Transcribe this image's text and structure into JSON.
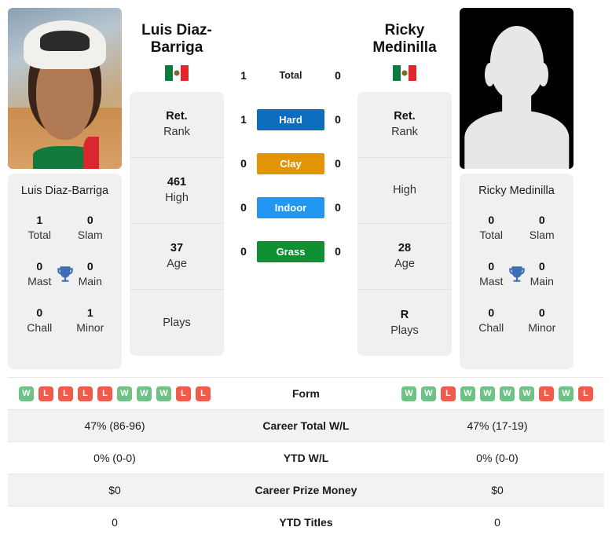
{
  "players": {
    "left": {
      "name": "Luis Diaz-Barriga",
      "name_line1": "Luis Diaz-",
      "name_line2": "Barriga",
      "flag": "mexico-flag",
      "photo": "player-photo",
      "rank": "Ret.",
      "rank_label": "Rank",
      "high": "461",
      "high_label": "High",
      "age": "37",
      "age_label": "Age",
      "plays": "",
      "plays_label": "Plays",
      "titles": {
        "total": "1",
        "total_label": "Total",
        "slam": "0",
        "slam_label": "Slam",
        "mast": "0",
        "mast_label": "Mast",
        "main": "0",
        "main_label": "Main",
        "chall": "0",
        "chall_label": "Chall",
        "minor": "1",
        "minor_label": "Minor"
      },
      "form": [
        "W",
        "L",
        "L",
        "L",
        "L",
        "W",
        "W",
        "W",
        "L",
        "L"
      ],
      "career_total_wl": "47% (86-96)",
      "ytd_wl": "0% (0-0)",
      "career_prize_money": "$0",
      "ytd_titles": "0"
    },
    "right": {
      "name": "Ricky Medinilla",
      "name_line1": "Ricky",
      "name_line2": "Medinilla",
      "flag": "mexico-flag",
      "photo": "player-photo-placeholder",
      "rank": "Ret.",
      "rank_label": "Rank",
      "high": "",
      "high_label": "High",
      "age": "28",
      "age_label": "Age",
      "plays": "R",
      "plays_label": "Plays",
      "titles": {
        "total": "0",
        "total_label": "Total",
        "slam": "0",
        "slam_label": "Slam",
        "mast": "0",
        "mast_label": "Mast",
        "main": "0",
        "main_label": "Main",
        "chall": "0",
        "chall_label": "Chall",
        "minor": "0",
        "minor_label": "Minor"
      },
      "form": [
        "W",
        "W",
        "L",
        "W",
        "W",
        "W",
        "W",
        "L",
        "W",
        "L"
      ],
      "career_total_wl": "47% (17-19)",
      "ytd_wl": "0% (0-0)",
      "career_prize_money": "$0",
      "ytd_titles": "0"
    }
  },
  "surfaces": [
    {
      "label": "Total",
      "left": "1",
      "right": "0",
      "color": "",
      "plain": true
    },
    {
      "label": "Hard",
      "left": "1",
      "right": "0",
      "color": "#0c6cbe",
      "plain": false
    },
    {
      "label": "Clay",
      "left": "0",
      "right": "0",
      "color": "#e29405",
      "plain": false
    },
    {
      "label": "Indoor",
      "left": "0",
      "right": "0",
      "color": "#2196f3",
      "plain": false
    },
    {
      "label": "Grass",
      "left": "0",
      "right": "0",
      "color": "#119033",
      "plain": false
    }
  ],
  "table_rows": [
    {
      "label": "Form",
      "left": "",
      "right": "",
      "is_form": true,
      "alt": false
    },
    {
      "label": "Career Total W/L",
      "left": "47% (86-96)",
      "right": "47% (17-19)",
      "is_form": false,
      "alt": true
    },
    {
      "label": "YTD W/L",
      "left": "0% (0-0)",
      "right": "0% (0-0)",
      "is_form": false,
      "alt": false
    },
    {
      "label": "Career Prize Money",
      "left": "$0",
      "right": "$0",
      "is_form": false,
      "alt": true
    },
    {
      "label": "YTD Titles",
      "left": "0",
      "right": "0",
      "is_form": false,
      "alt": false
    }
  ],
  "colors": {
    "win": "#6fc286",
    "loss": "#f15b4b",
    "card_bg": "#f0f0f0",
    "row_alt": "#f2f2f2",
    "trophy": "#3d6fb4"
  },
  "icons": {
    "trophy": "trophy-icon",
    "flag": "mexico-flag-icon"
  }
}
